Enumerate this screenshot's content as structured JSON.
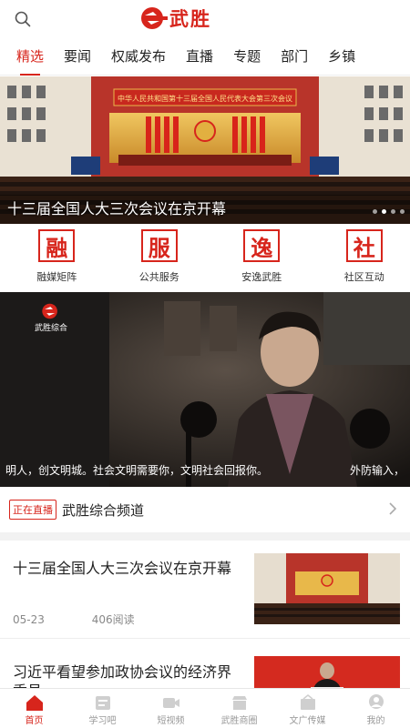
{
  "header": {
    "logo_text": "武胜",
    "search_icon": "search-icon"
  },
  "tabs": [
    {
      "label": "精选",
      "active": true
    },
    {
      "label": "要闻"
    },
    {
      "label": "权威发布"
    },
    {
      "label": "直播"
    },
    {
      "label": "专题"
    },
    {
      "label": "部门"
    },
    {
      "label": "乡镇"
    }
  ],
  "hero": {
    "caption": "十三届全国人大三次会议在京开幕",
    "banner_text": "中华人民共和国第十三届全国人民代表大会第三次会议",
    "slide_count": 4,
    "active_slide": 2
  },
  "quick_links": [
    {
      "glyph": "融",
      "label": "融媒矩阵"
    },
    {
      "glyph": "服",
      "label": "公共服务"
    },
    {
      "glyph": "逸",
      "label": "安逸武胜"
    },
    {
      "glyph": "社",
      "label": "社区互动"
    }
  ],
  "video": {
    "channel_logo": "武胜综合",
    "subtitle": "明人，创文明城。社会文明需要你，文明社会回报你。",
    "subtitle_right": "外防输入，"
  },
  "live": {
    "badge": "正在直播",
    "title": "武胜综合频道"
  },
  "news": [
    {
      "title": "十三届全国人大三次会议在京开幕",
      "date": "05-23",
      "reads": "406阅读"
    },
    {
      "title": "习近平看望参加政协会议的经济界委员"
    }
  ],
  "bottom_nav": [
    {
      "label": "首页",
      "icon": "home-icon",
      "active": true
    },
    {
      "label": "学习吧",
      "icon": "study-icon"
    },
    {
      "label": "短视频",
      "icon": "video-icon"
    },
    {
      "label": "武胜商圈",
      "icon": "shop-icon"
    },
    {
      "label": "文广传媒",
      "icon": "media-icon"
    },
    {
      "label": "我的",
      "icon": "profile-icon"
    }
  ],
  "colors": {
    "accent": "#d7251c",
    "muted": "#999999"
  }
}
